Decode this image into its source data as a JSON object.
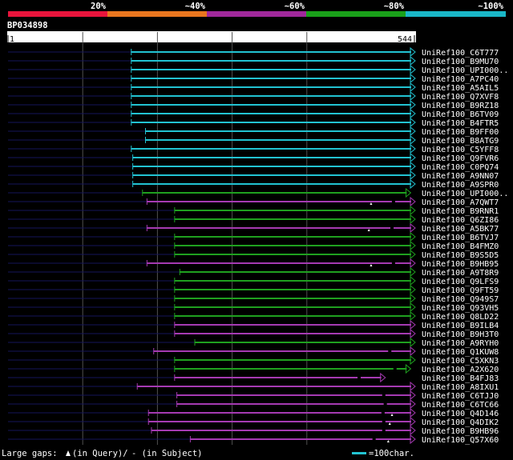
{
  "legend_bar": {
    "labels": [
      "20%",
      "~40%",
      "~60%",
      "~80%",
      "~100%"
    ],
    "colors": [
      "#e8143c",
      "#e9761f",
      "#a0289b",
      "#1aa01a",
      "#1ab7c8"
    ]
  },
  "query": {
    "accession": "BP034898",
    "start_label": "1",
    "end_label": "544",
    "length": 544
  },
  "colors": {
    "background": "#000000",
    "unaligned": "#14145a",
    "gridline": "#505050",
    "scale_bar": "#ffffff",
    "cyan": "#22c3d2",
    "green": "#1fa01f",
    "purple": "#a53ab2"
  },
  "hits": [
    {
      "name": "UniRef100_C6T777",
      "start": 165,
      "end": 544,
      "color": "cyan",
      "gaps": []
    },
    {
      "name": "UniRef100_B9MU70",
      "start": 165,
      "end": 544,
      "color": "cyan",
      "gaps": []
    },
    {
      "name": "UniRef100_UPI000..",
      "start": 165,
      "end": 544,
      "color": "cyan",
      "gaps": []
    },
    {
      "name": "UniRef100_A7PC40",
      "start": 165,
      "end": 544,
      "color": "cyan",
      "gaps": []
    },
    {
      "name": "UniRef100_A5AIL5",
      "start": 165,
      "end": 544,
      "color": "cyan",
      "gaps": []
    },
    {
      "name": "UniRef100_Q7XVF8",
      "start": 165,
      "end": 544,
      "color": "cyan",
      "gaps": []
    },
    {
      "name": "UniRef100_B9RZ18",
      "start": 165,
      "end": 544,
      "color": "cyan",
      "gaps": []
    },
    {
      "name": "UniRef100_B6TV09",
      "start": 165,
      "end": 544,
      "color": "cyan",
      "gaps": []
    },
    {
      "name": "UniRef100_B4FTR5",
      "start": 165,
      "end": 544,
      "color": "cyan",
      "gaps": []
    },
    {
      "name": "UniRef100_B9FF00",
      "start": 184,
      "end": 544,
      "color": "cyan",
      "gaps": []
    },
    {
      "name": "UniRef100_B8ATG9",
      "start": 184,
      "end": 544,
      "color": "cyan",
      "gaps": []
    },
    {
      "name": "UniRef100_C5YFF8",
      "start": 165,
      "end": 544,
      "color": "cyan",
      "gaps": []
    },
    {
      "name": "UniRef100_Q9FVR6",
      "start": 167,
      "end": 544,
      "color": "cyan",
      "gaps": []
    },
    {
      "name": "UniRef100_C0PQ74",
      "start": 167,
      "end": 544,
      "color": "cyan",
      "gaps": []
    },
    {
      "name": "UniRef100_A9NN07",
      "start": 167,
      "end": 544,
      "color": "cyan",
      "gaps": []
    },
    {
      "name": "UniRef100_A9SPR0",
      "start": 167,
      "end": 544,
      "color": "cyan",
      "gaps": []
    },
    {
      "name": "UniRef100_UPI000..",
      "start": 180,
      "end": 538,
      "color": "green",
      "gaps": []
    },
    {
      "name": "UniRef100_A7QWT7",
      "start": 186,
      "end": 544,
      "color": "purple",
      "gaps": [
        {
          "pos": 486,
          "type": "query"
        },
        {
          "pos": 516,
          "type": "subject"
        }
      ]
    },
    {
      "name": "UniRef100_B9RNR1",
      "start": 223,
      "end": 544,
      "color": "green",
      "gaps": []
    },
    {
      "name": "UniRef100_Q6ZI86",
      "start": 223,
      "end": 544,
      "color": "green",
      "gaps": []
    },
    {
      "name": "UniRef100_A5BK77",
      "start": 186,
      "end": 544,
      "color": "purple",
      "gaps": [
        {
          "pos": 483,
          "type": "query"
        },
        {
          "pos": 514,
          "type": "subject"
        }
      ]
    },
    {
      "name": "UniRef100_B6TVJ7",
      "start": 223,
      "end": 544,
      "color": "green",
      "gaps": []
    },
    {
      "name": "UniRef100_B4FMZ0",
      "start": 223,
      "end": 544,
      "color": "green",
      "gaps": []
    },
    {
      "name": "UniRef100_B9S5D5",
      "start": 223,
      "end": 544,
      "color": "green",
      "gaps": []
    },
    {
      "name": "UniRef100_B9HB95",
      "start": 186,
      "end": 544,
      "color": "purple",
      "gaps": [
        {
          "pos": 486,
          "type": "query"
        },
        {
          "pos": 516,
          "type": "subject"
        }
      ]
    },
    {
      "name": "UniRef100_A9T8R9",
      "start": 230,
      "end": 544,
      "color": "green",
      "gaps": []
    },
    {
      "name": "UniRef100_Q9LFS9",
      "start": 223,
      "end": 544,
      "color": "green",
      "gaps": []
    },
    {
      "name": "UniRef100_Q9FT59",
      "start": 223,
      "end": 544,
      "color": "green",
      "gaps": []
    },
    {
      "name": "UniRef100_Q949S7",
      "start": 223,
      "end": 544,
      "color": "green",
      "gaps": []
    },
    {
      "name": "UniRef100_Q93VH5",
      "start": 223,
      "end": 544,
      "color": "green",
      "gaps": []
    },
    {
      "name": "UniRef100_Q8LD22",
      "start": 223,
      "end": 544,
      "color": "green",
      "gaps": []
    },
    {
      "name": "UniRef100_B9ILB4",
      "start": 223,
      "end": 544,
      "color": "purple",
      "gaps": []
    },
    {
      "name": "UniRef100_B9H3T0",
      "start": 223,
      "end": 544,
      "color": "purple",
      "gaps": []
    },
    {
      "name": "UniRef100_A9RYH0",
      "start": 250,
      "end": 544,
      "color": "green",
      "gaps": []
    },
    {
      "name": "UniRef100_Q1KUW8",
      "start": 195,
      "end": 544,
      "color": "purple",
      "gaps": [
        {
          "pos": 511,
          "type": "subject"
        }
      ]
    },
    {
      "name": "UniRef100_C5XKN3",
      "start": 223,
      "end": 544,
      "color": "green",
      "gaps": []
    },
    {
      "name": "UniRef100_A2X620",
      "start": 223,
      "end": 538,
      "color": "green",
      "gaps": [
        {
          "pos": 518,
          "type": "subject"
        }
      ]
    },
    {
      "name": "UniRef100_B4FJ83",
      "start": 223,
      "end": 504,
      "color": "purple",
      "gaps": [
        {
          "pos": 470,
          "type": "subject"
        }
      ]
    },
    {
      "name": "UniRef100_A8IXU1",
      "start": 173,
      "end": 544,
      "color": "purple",
      "gaps": []
    },
    {
      "name": "UniRef100_C6TJJ0",
      "start": 226,
      "end": 544,
      "color": "purple",
      "gaps": [
        {
          "pos": 503,
          "type": "subject"
        }
      ]
    },
    {
      "name": "UniRef100_C6TC66",
      "start": 226,
      "end": 544,
      "color": "purple",
      "gaps": [
        {
          "pos": 505,
          "type": "subject"
        }
      ]
    },
    {
      "name": "UniRef100_Q4D146",
      "start": 188,
      "end": 544,
      "color": "purple",
      "gaps": [
        {
          "pos": 514,
          "type": "query"
        },
        {
          "pos": 502,
          "type": "subject"
        }
      ]
    },
    {
      "name": "UniRef100_Q4DIK2",
      "start": 188,
      "end": 544,
      "color": "purple",
      "gaps": [
        {
          "pos": 511,
          "type": "query"
        },
        {
          "pos": 503,
          "type": "subject"
        }
      ]
    },
    {
      "name": "UniRef100_B9HB96",
      "start": 192,
      "end": 544,
      "color": "purple",
      "gaps": [
        {
          "pos": 503,
          "type": "subject"
        }
      ]
    },
    {
      "name": "UniRef100_Q57X60",
      "start": 244,
      "end": 544,
      "color": "purple",
      "gaps": [
        {
          "pos": 509,
          "type": "query"
        },
        {
          "pos": 490,
          "type": "subject"
        }
      ]
    }
  ],
  "footer": {
    "gaps_prefix": "Large gaps: ",
    "query_gap_text": "(in Query)/",
    "subject_gap_text": "- (in Subject)",
    "scale_text": "=100char."
  }
}
